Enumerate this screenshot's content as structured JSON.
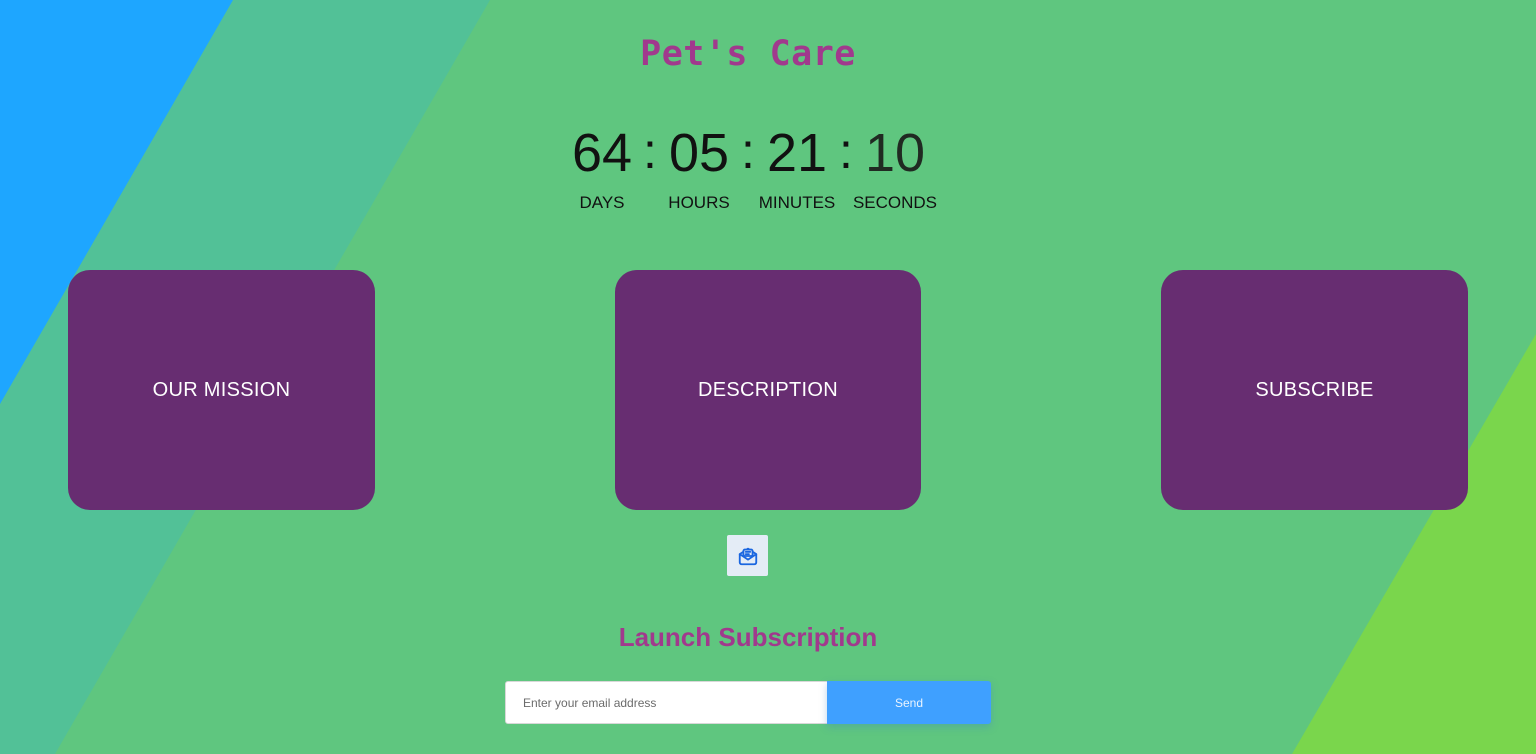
{
  "header": {
    "title": "Pet's Care"
  },
  "countdown": {
    "days": "64",
    "hours": "05",
    "minutes": "21",
    "seconds": "10",
    "separator": ":",
    "labels": {
      "days": "DAYS",
      "hours": "HOURS",
      "minutes": "MINUTES",
      "seconds": "SECONDS"
    }
  },
  "cards": [
    {
      "label": "OUR MISSION"
    },
    {
      "label": "DESCRIPTION"
    },
    {
      "label": "SUBSCRIBE"
    }
  ],
  "subscription": {
    "icon": "mail-open-icon",
    "title": "Launch Subscription",
    "email_placeholder": "Enter your email address",
    "email_value": "",
    "send_label": "Send"
  },
  "colors": {
    "background_green": "#5fc67f",
    "stripe_blue": "#1ea6ff",
    "stripe_teal": "#52c197",
    "stripe_lime": "#7ad64c",
    "card_purple": "#672d71",
    "title_magenta": "#a1398d",
    "send_blue": "#3fa0ff",
    "icon_blue": "#1a66e0"
  }
}
